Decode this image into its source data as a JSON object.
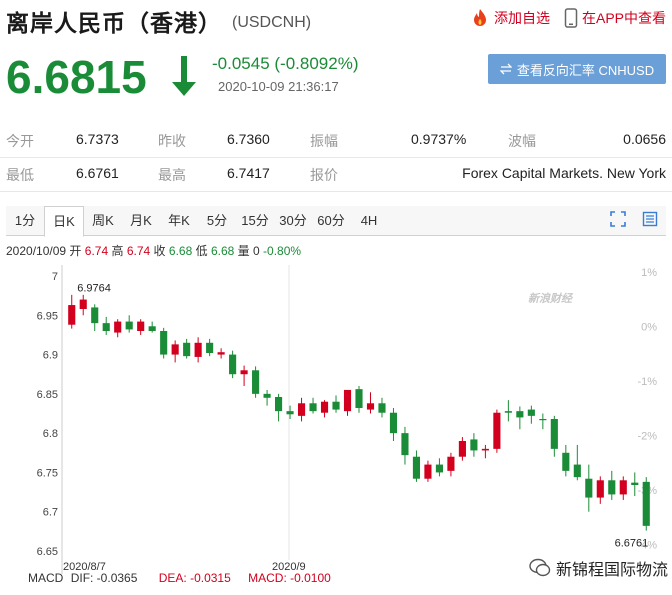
{
  "header": {
    "title": "离岸人民币（香港）",
    "code": "(USDCNH)"
  },
  "actions": {
    "add_watch": "添加自选",
    "open_app": "在APP中查看"
  },
  "quote": {
    "price": "6.6815",
    "change": "-0.0545 (-0.8092%)",
    "time": "2020-10-09 21:36:17"
  },
  "reverse_btn": "查看反向汇率 CNHUSD",
  "stats": {
    "row1": [
      {
        "label": "今开",
        "value": "6.7373"
      },
      {
        "label": "昨收",
        "value": "6.7360"
      },
      {
        "label": "振幅",
        "value": "0.9737%"
      },
      {
        "label": "波幅",
        "value": "0.0656"
      }
    ],
    "row2": [
      {
        "label": "最低",
        "value": "6.6761"
      },
      {
        "label": "最高",
        "value": "6.7417"
      },
      {
        "label": "报价",
        "value": "Forex Capital Markets. New York"
      }
    ]
  },
  "tabs": [
    "1分",
    "日K",
    "周K",
    "月K",
    "年K",
    "5分",
    "15分",
    "30分",
    "60分",
    "4H"
  ],
  "active_tab": 1,
  "ohlc": {
    "date": "2020/10/09",
    "open_label": "开",
    "open": "6.74",
    "high_label": "高",
    "high": "6.74",
    "close_label": "收",
    "close": "6.68",
    "low_label": "低",
    "low": "6.68",
    "vol_label": "量",
    "vol": "0",
    "pct": "-0.80%"
  },
  "watermark": "新浪财经",
  "macd": {
    "label": "MACD",
    "dif": "DIF: -0.0365",
    "dea": "DEA: -0.0315",
    "macd": "MACD: -0.0100"
  },
  "brand": "新锦程国际物流",
  "colors": {
    "up": "#d2001e",
    "down": "#1a8c37",
    "accent": "#6a9fd8"
  },
  "chart_data": {
    "type": "candlestick",
    "y_ticks": [
      "7",
      "6.95",
      "6.9",
      "6.85",
      "6.8",
      "6.75",
      "6.7",
      "6.65"
    ],
    "y_ticks_right": [
      "1%",
      "0%",
      "-1%",
      "-2%",
      "-3%",
      "-4%"
    ],
    "x_ticks": [
      "2020/8/7",
      "2020/9"
    ],
    "annotations": {
      "max": "6.9764",
      "min": "6.6761"
    },
    "ylim": [
      6.65,
      7.0
    ],
    "candles": [
      {
        "o": 6.938,
        "h": 6.976,
        "l": 6.933,
        "c": 6.963
      },
      {
        "o": 6.958,
        "h": 6.976,
        "l": 6.95,
        "c": 6.97
      },
      {
        "o": 6.96,
        "h": 6.964,
        "l": 6.93,
        "c": 6.94
      },
      {
        "o": 6.94,
        "h": 6.948,
        "l": 6.925,
        "c": 6.93
      },
      {
        "o": 6.928,
        "h": 6.945,
        "l": 6.922,
        "c": 6.942
      },
      {
        "o": 6.942,
        "h": 6.95,
        "l": 6.928,
        "c": 6.932
      },
      {
        "o": 6.93,
        "h": 6.945,
        "l": 6.925,
        "c": 6.942
      },
      {
        "o": 6.936,
        "h": 6.942,
        "l": 6.928,
        "c": 6.93
      },
      {
        "o": 6.93,
        "h": 6.934,
        "l": 6.895,
        "c": 6.9
      },
      {
        "o": 6.9,
        "h": 6.918,
        "l": 6.89,
        "c": 6.913
      },
      {
        "o": 6.915,
        "h": 6.92,
        "l": 6.895,
        "c": 6.898
      },
      {
        "o": 6.897,
        "h": 6.922,
        "l": 6.89,
        "c": 6.915
      },
      {
        "o": 6.915,
        "h": 6.92,
        "l": 6.898,
        "c": 6.902
      },
      {
        "o": 6.9,
        "h": 6.908,
        "l": 6.895,
        "c": 6.903
      },
      {
        "o": 6.9,
        "h": 6.905,
        "l": 6.87,
        "c": 6.875
      },
      {
        "o": 6.875,
        "h": 6.886,
        "l": 6.86,
        "c": 6.88
      },
      {
        "o": 6.88,
        "h": 6.885,
        "l": 6.845,
        "c": 6.85
      },
      {
        "o": 6.85,
        "h": 6.855,
        "l": 6.835,
        "c": 6.845
      },
      {
        "o": 6.846,
        "h": 6.85,
        "l": 6.815,
        "c": 6.828
      },
      {
        "o": 6.828,
        "h": 6.835,
        "l": 6.818,
        "c": 6.824
      },
      {
        "o": 6.822,
        "h": 6.845,
        "l": 6.815,
        "c": 6.838
      },
      {
        "o": 6.838,
        "h": 6.845,
        "l": 6.825,
        "c": 6.828
      },
      {
        "o": 6.826,
        "h": 6.842,
        "l": 6.82,
        "c": 6.84
      },
      {
        "o": 6.84,
        "h": 6.848,
        "l": 6.826,
        "c": 6.83
      },
      {
        "o": 6.828,
        "h": 6.85,
        "l": 6.822,
        "c": 6.855
      },
      {
        "o": 6.856,
        "h": 6.86,
        "l": 6.826,
        "c": 6.832
      },
      {
        "o": 6.83,
        "h": 6.852,
        "l": 6.825,
        "c": 6.838
      },
      {
        "o": 6.838,
        "h": 6.845,
        "l": 6.82,
        "c": 6.826
      },
      {
        "o": 6.826,
        "h": 6.832,
        "l": 6.79,
        "c": 6.8
      },
      {
        "o": 6.8,
        "h": 6.808,
        "l": 6.76,
        "c": 6.772
      },
      {
        "o": 6.77,
        "h": 6.778,
        "l": 6.738,
        "c": 6.742
      },
      {
        "o": 6.742,
        "h": 6.765,
        "l": 6.738,
        "c": 6.76
      },
      {
        "o": 6.76,
        "h": 6.768,
        "l": 6.745,
        "c": 6.75
      },
      {
        "o": 6.752,
        "h": 6.775,
        "l": 6.745,
        "c": 6.77
      },
      {
        "o": 6.77,
        "h": 6.795,
        "l": 6.765,
        "c": 6.79
      },
      {
        "o": 6.792,
        "h": 6.8,
        "l": 6.77,
        "c": 6.778
      },
      {
        "o": 6.778,
        "h": 6.785,
        "l": 6.768,
        "c": 6.78
      },
      {
        "o": 6.78,
        "h": 6.83,
        "l": 6.775,
        "c": 6.826
      },
      {
        "o": 6.828,
        "h": 6.842,
        "l": 6.815,
        "c": 6.826
      },
      {
        "o": 6.828,
        "h": 6.834,
        "l": 6.805,
        "c": 6.82
      },
      {
        "o": 6.83,
        "h": 6.835,
        "l": 6.812,
        "c": 6.822
      },
      {
        "o": 6.818,
        "h": 6.825,
        "l": 6.805,
        "c": 6.817
      },
      {
        "o": 6.818,
        "h": 6.822,
        "l": 6.77,
        "c": 6.78
      },
      {
        "o": 6.775,
        "h": 6.785,
        "l": 6.745,
        "c": 6.752
      },
      {
        "o": 6.76,
        "h": 6.785,
        "l": 6.74,
        "c": 6.744
      },
      {
        "o": 6.742,
        "h": 6.76,
        "l": 6.7,
        "c": 6.718
      },
      {
        "o": 6.718,
        "h": 6.745,
        "l": 6.71,
        "c": 6.74
      },
      {
        "o": 6.74,
        "h": 6.752,
        "l": 6.715,
        "c": 6.722
      },
      {
        "o": 6.722,
        "h": 6.745,
        "l": 6.715,
        "c": 6.74
      },
      {
        "o": 6.737,
        "h": 6.75,
        "l": 6.72,
        "c": 6.734
      },
      {
        "o": 6.738,
        "h": 6.744,
        "l": 6.676,
        "c": 6.682
      }
    ]
  }
}
